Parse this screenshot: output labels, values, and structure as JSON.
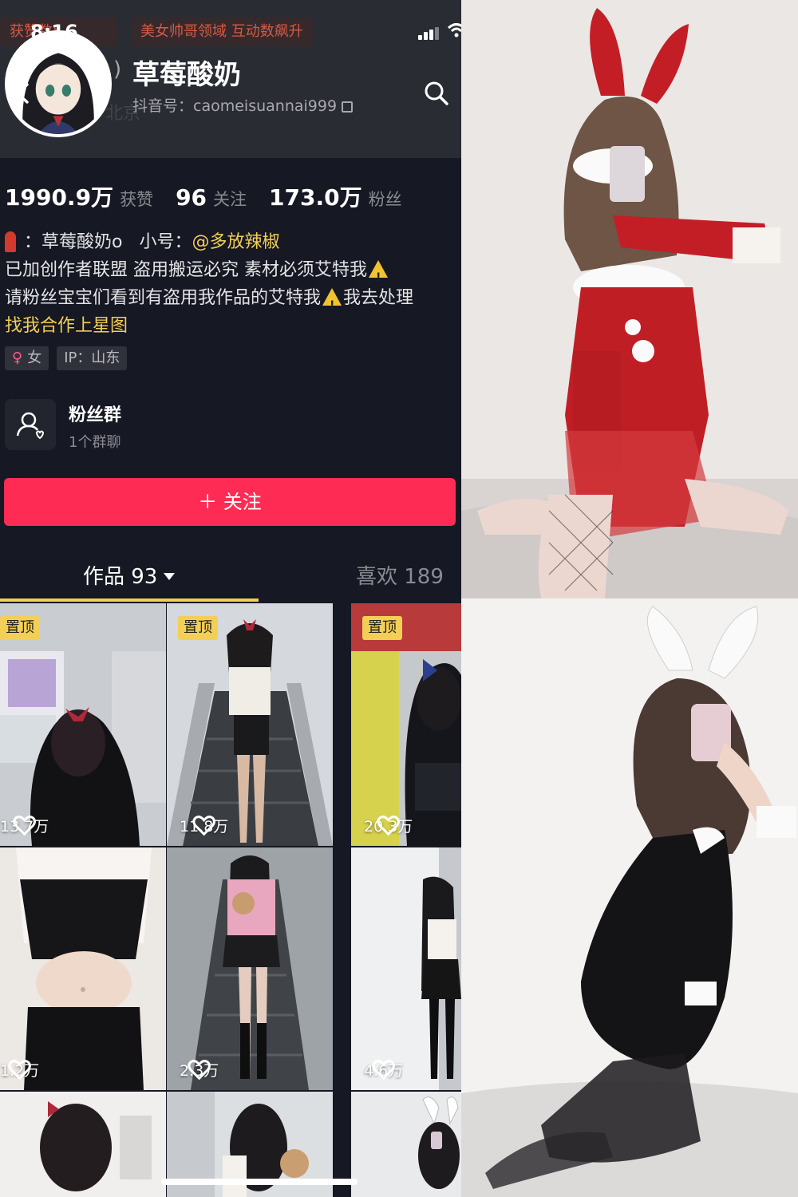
{
  "status_bar": {
    "time": "8:16"
  },
  "banners": {
    "left": "获赞数5",
    "right": "美女帅哥领域 互动数飙升"
  },
  "header": {
    "name": "草莓酸奶",
    "paren": ")",
    "id_label": "抖音号：caomeisuannai999",
    "ghost_location": "北京"
  },
  "stats": [
    {
      "num": "1990.9万",
      "label": "获赞"
    },
    {
      "num": "96",
      "label": "关注"
    },
    {
      "num": "173.0万",
      "label": "粉丝"
    }
  ],
  "bio": {
    "line1_prefix": "：草莓酸奶o",
    "line1_small": "小号：",
    "line1_link": "@多放辣椒",
    "line2": "已加创作者联盟 盗用搬运必究 素材必须艾特我",
    "line3a": "请粉丝宝宝们看到有盗用我作品的艾特我",
    "line3b": "我去处理",
    "line4": "找我合作上星图"
  },
  "badges": {
    "gender": "女",
    "ip": "IP：山东"
  },
  "fan_group": {
    "title": "粉丝群",
    "sub": "1个群聊"
  },
  "follow_button": "＋ 关注",
  "tabs": {
    "works": "作品 93",
    "likes": "喜欢 189"
  },
  "pin_label": "置顶",
  "videos": [
    {
      "likes": "13.7万",
      "pinned": true
    },
    {
      "likes": "11.8万",
      "pinned": true
    },
    {
      "likes": "20.3万",
      "pinned": true
    },
    {
      "likes": "1.2万",
      "pinned": false
    },
    {
      "likes": "2.3万",
      "pinned": false
    },
    {
      "likes": "4.6万",
      "pinned": false
    }
  ],
  "colors": {
    "accent_red": "#fe2c55",
    "accent_yellow": "#f3cf55",
    "bg": "#161823"
  }
}
